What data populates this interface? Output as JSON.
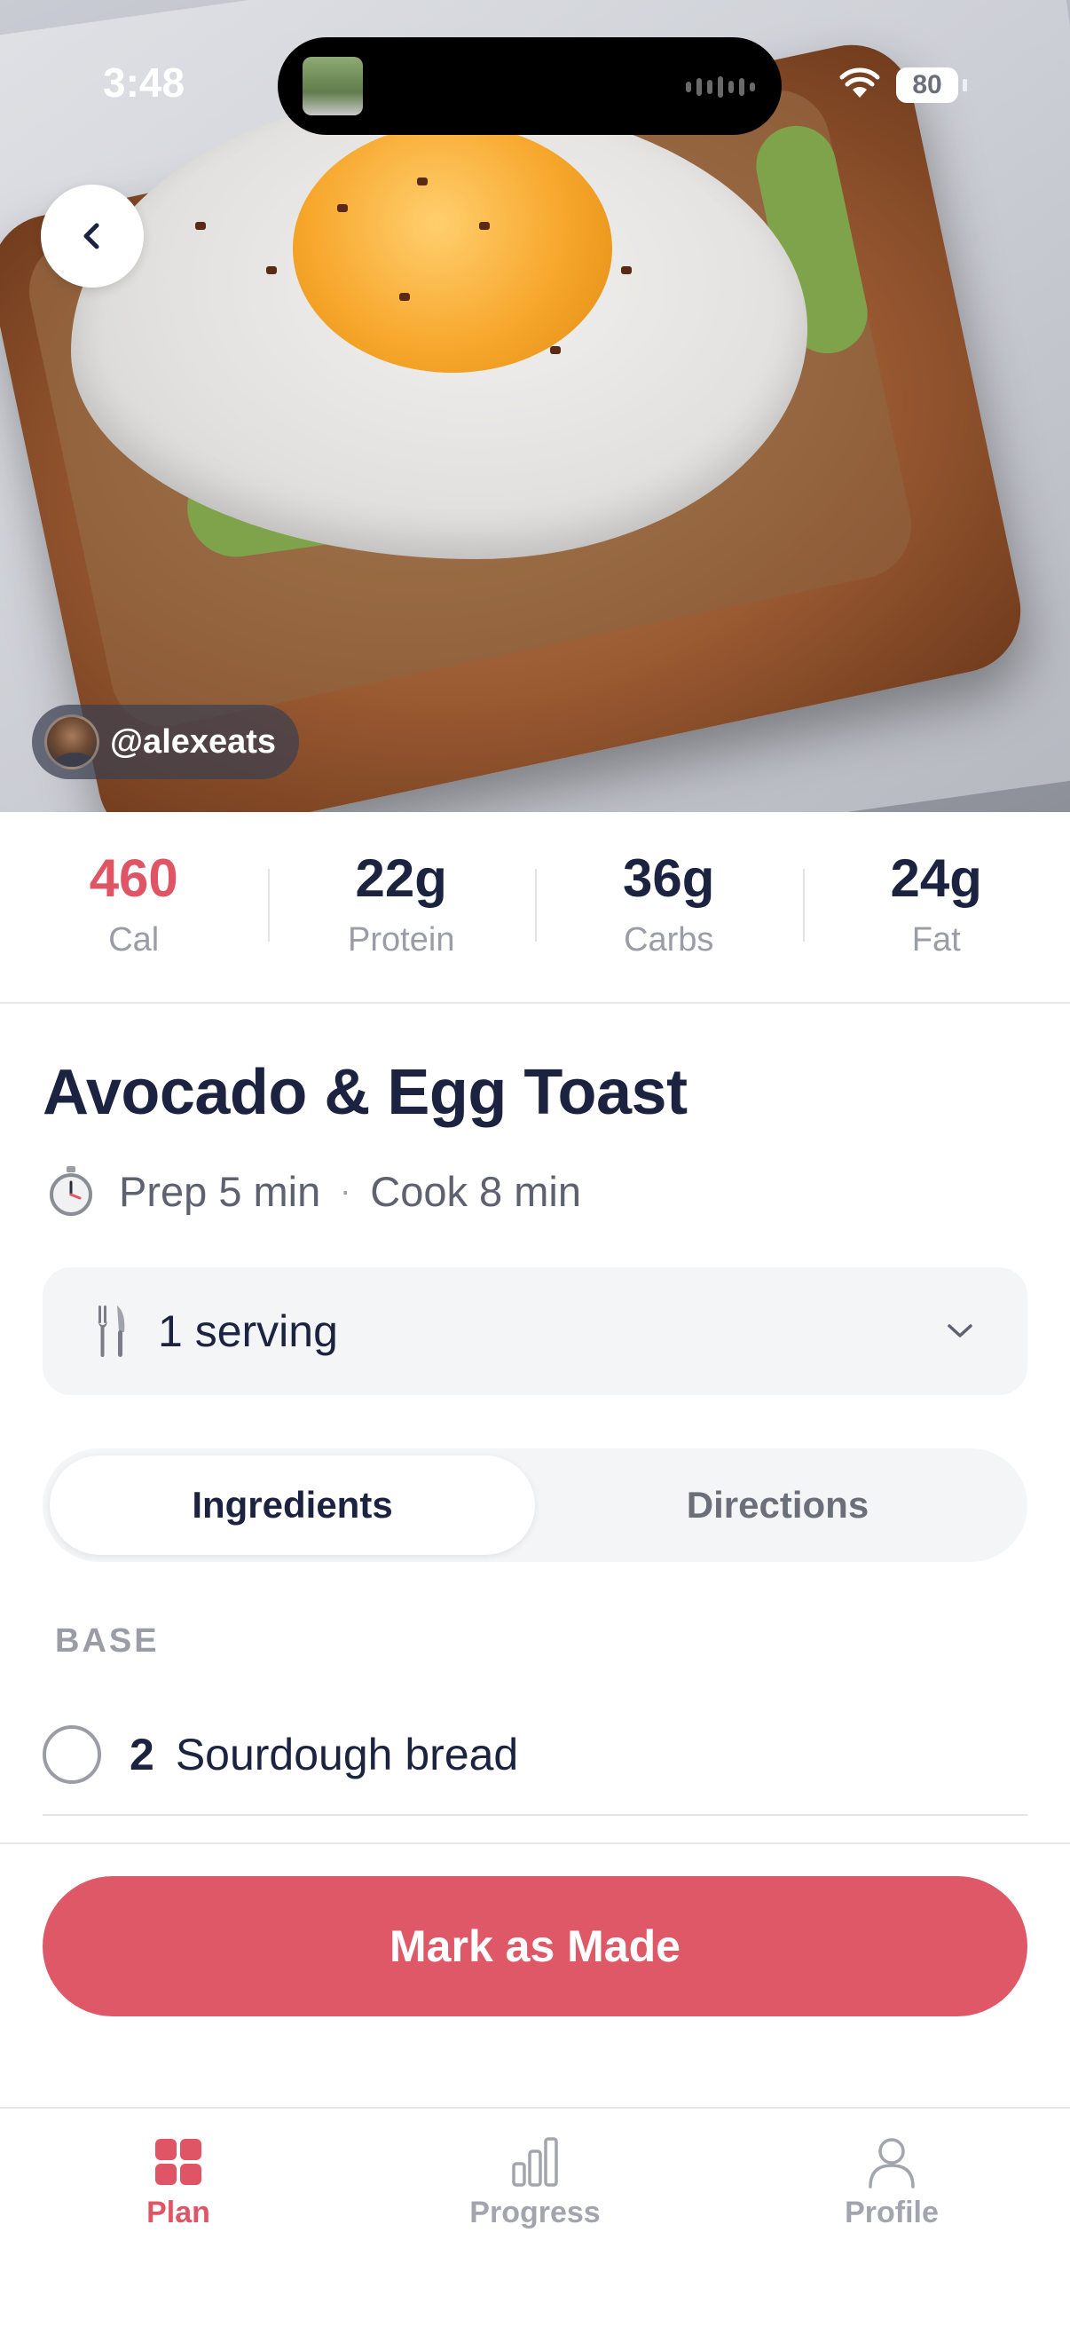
{
  "status_bar": {
    "time": "3:48",
    "battery": "80"
  },
  "hero": {
    "creator_handle": "@alexeats",
    "back_icon": "chevron-left-icon"
  },
  "nutrition": [
    {
      "value": "460",
      "label": "Cal",
      "highlight": true
    },
    {
      "value": "22g",
      "label": "Protein"
    },
    {
      "value": "36g",
      "label": "Carbs"
    },
    {
      "value": "24g",
      "label": "Fat"
    }
  ],
  "recipe": {
    "title": "Avocado & Egg Toast",
    "prep": "Prep 5 min",
    "separator": "·",
    "cook": "Cook 8 min"
  },
  "serving": {
    "label": "1 serving"
  },
  "tabs": {
    "ingredients": "Ingredients",
    "directions": "Directions",
    "active": "Ingredients"
  },
  "ingredients": {
    "section": "BASE",
    "items": [
      {
        "qty": "2",
        "name": "Sourdough bread",
        "checked": false
      }
    ]
  },
  "cta": {
    "label": "Mark as Made"
  },
  "bottom_nav": [
    {
      "label": "Plan",
      "icon": "grid-icon",
      "active": true
    },
    {
      "label": "Progress",
      "icon": "bar-chart-icon",
      "active": false
    },
    {
      "label": "Profile",
      "icon": "person-icon",
      "active": false
    }
  ],
  "colors": {
    "accent": "#df5868",
    "text": "#1c2340",
    "muted": "#9a9ca6"
  }
}
